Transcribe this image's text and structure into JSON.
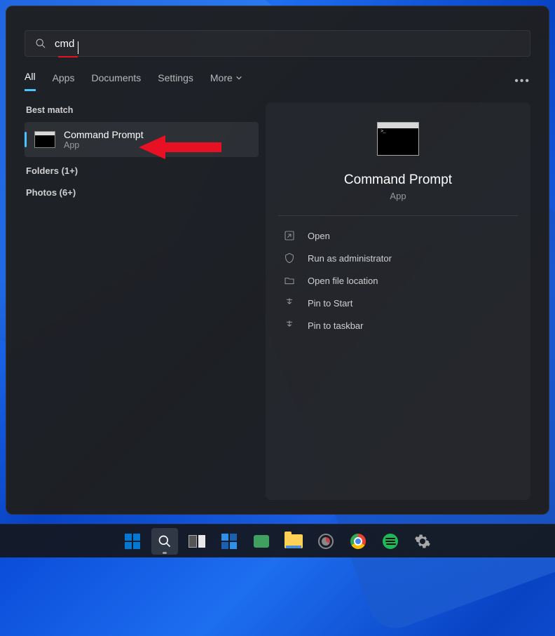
{
  "search": {
    "value": "cmd"
  },
  "tabs": {
    "all": "All",
    "apps": "Apps",
    "documents": "Documents",
    "settings": "Settings",
    "more": "More"
  },
  "left": {
    "best_match_label": "Best match",
    "result": {
      "title": "Command Prompt",
      "subtitle": "App"
    },
    "folders": "Folders (1+)",
    "photos": "Photos (6+)"
  },
  "preview": {
    "title": "Command Prompt",
    "subtitle": "App",
    "actions": {
      "open": "Open",
      "admin": "Run as administrator",
      "location": "Open file location",
      "pin_start": "Pin to Start",
      "pin_taskbar": "Pin to taskbar"
    }
  }
}
